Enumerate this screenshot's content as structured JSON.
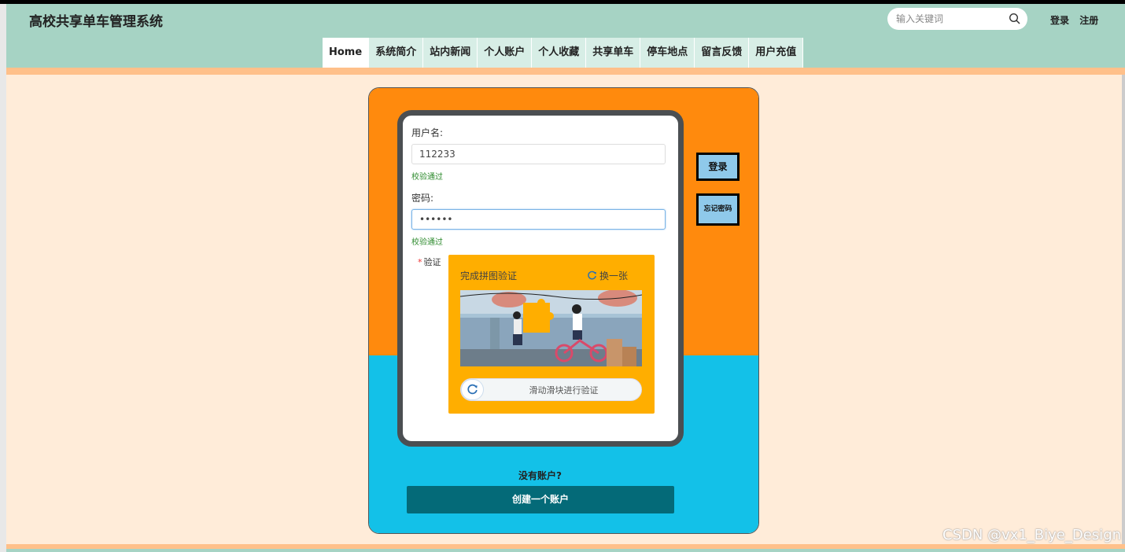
{
  "site": {
    "title": "高校共享单车管理系统"
  },
  "search": {
    "placeholder": "输入关键词"
  },
  "auth": {
    "login": "登录",
    "register": "注册"
  },
  "nav": {
    "items": [
      {
        "label": "Home"
      },
      {
        "label": "系统简介"
      },
      {
        "label": "站内新闻"
      },
      {
        "label": "个人账户"
      },
      {
        "label": "个人收藏"
      },
      {
        "label": "共享单车"
      },
      {
        "label": "停车地点"
      },
      {
        "label": "留言反馈"
      },
      {
        "label": "用户充值"
      }
    ],
    "active_index": 0
  },
  "form": {
    "username_label": "用户名:",
    "username_value": "112233",
    "username_status": "校验通过",
    "password_label": "密码:",
    "password_value": "••••••",
    "password_status": "校验通过",
    "captcha_label": "验证",
    "captcha_required_mark": "*",
    "captcha_title": "完成拼图验证",
    "captcha_refresh": "换一张",
    "slider_text": "滑动滑块进行验证"
  },
  "side_buttons": {
    "login": "登录",
    "forgot": "忘记密码"
  },
  "signup": {
    "prompt": "没有账户?",
    "create": "创建一个账户"
  },
  "watermark": "CSDN @vx1_Biye_Design",
  "colors": {
    "header": "#a6d3c4",
    "page_bg": "#ffecd9",
    "card_top": "#ff8a0d",
    "card_bottom": "#13c1e8",
    "captcha_panel": "#ffae00",
    "create_button": "#046a78",
    "side_button": "#8fc9ea"
  }
}
